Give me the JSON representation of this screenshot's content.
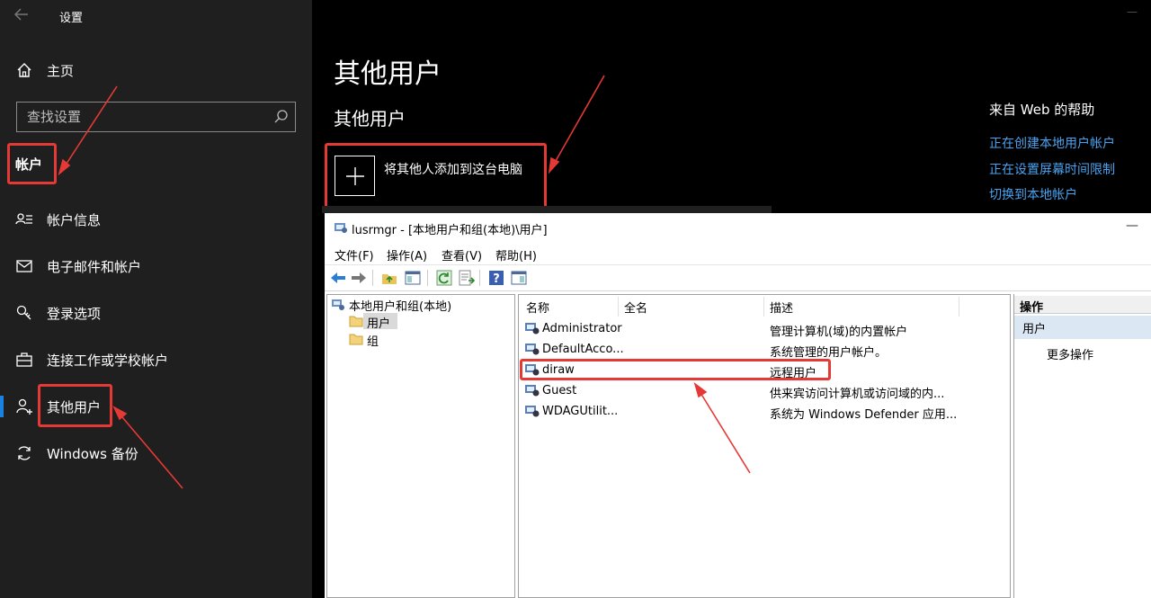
{
  "settings": {
    "app_title": "设置",
    "home_label": "主页",
    "search_placeholder": "查找设置",
    "section_heading": "帐户",
    "nav_items": [
      {
        "label": "帐户信息",
        "icon": "person-card-icon"
      },
      {
        "label": "电子邮件和帐户",
        "icon": "mail-icon"
      },
      {
        "label": "登录选项",
        "icon": "key-icon"
      },
      {
        "label": "连接工作或学校帐户",
        "icon": "briefcase-icon"
      },
      {
        "label": "其他用户",
        "icon": "person-add-icon",
        "selected": true
      },
      {
        "label": "Windows 备份",
        "icon": "sync-icon"
      }
    ],
    "page_title": "其他用户",
    "sub_title": "其他用户",
    "add_button_label": "将其他人添加到这台电脑",
    "help": {
      "title": "来自 Web 的帮助",
      "links": [
        "正在创建本地用户帐户",
        "正在设置屏幕时间限制",
        "切换到本地帐户"
      ]
    }
  },
  "lusrmgr": {
    "title": "lusrmgr - [本地用户和组(本地)\\用户]",
    "menu": [
      "文件(F)",
      "操作(A)",
      "查看(V)",
      "帮助(H)"
    ],
    "tree": {
      "root": "本地用户和组(本地)",
      "children": [
        "用户",
        "组"
      ]
    },
    "columns": [
      "名称",
      "全名",
      "描述"
    ],
    "users": [
      {
        "name": "Administrator",
        "fullname": "",
        "desc": "管理计算机(域)的内置帐户"
      },
      {
        "name": "DefaultAcco...",
        "fullname": "",
        "desc": "系统管理的用户帐户。"
      },
      {
        "name": "diraw",
        "fullname": "",
        "desc": "远程用户"
      },
      {
        "name": "Guest",
        "fullname": "",
        "desc": "供来宾访问计算机或访问域的内..."
      },
      {
        "name": "WDAGUtilit...",
        "fullname": "",
        "desc": "系统为 Windows Defender 应用..."
      }
    ],
    "actions": {
      "header": "操作",
      "section": "用户",
      "more": "更多操作"
    }
  },
  "colors": {
    "accent_blue": "#1a82e2",
    "link_blue": "#4aa3f0",
    "highlight_red": "#e53935"
  }
}
